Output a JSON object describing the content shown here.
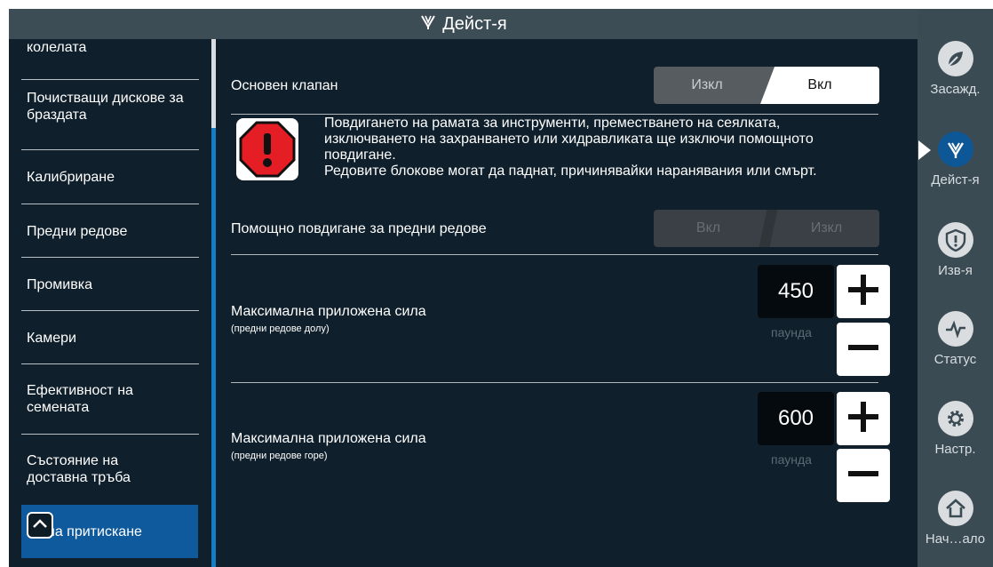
{
  "title": "Дейст-я",
  "left_menu": [
    {
      "label": "колелата"
    },
    {
      "label": "Почистващи дискове за браздата"
    },
    {
      "label": "Калибриране"
    },
    {
      "label": "Предни редове"
    },
    {
      "label": "Промивка"
    },
    {
      "label": "Камери"
    },
    {
      "label": "Ефективност на семената"
    },
    {
      "label": "Състояние на доставна тръба"
    },
    {
      "label": "Сила притискане",
      "active": true
    }
  ],
  "main_valve": {
    "label": "Основен клапан",
    "off": "Изкл",
    "on": "Вкл",
    "state": "Вкл"
  },
  "warning": {
    "line1": "Повдигането на рамата за инструменти, преместването на сеялката,",
    "line2": "изключването на захранването или хидравликата ще изключи помощното",
    "line3": "повдигане.",
    "line4": "Редовите блокове могат да паднат, причинявайки наранявания или смърт."
  },
  "assist_lift": {
    "label": "Помощно повдигане за предни редове",
    "on": "Вкл",
    "off": "Изкл",
    "state": "Изкл",
    "disabled": true
  },
  "force_down": {
    "label": "Максимална приложена сила",
    "sublabel": "(предни редове долу)",
    "value": "450",
    "unit": "паунда"
  },
  "force_up": {
    "label": "Максимална приложена сила",
    "sublabel": "(предни редове горе)",
    "value": "600",
    "unit": "паунда"
  },
  "right_nav": [
    {
      "label": "Засажд.",
      "icon": "planting-icon"
    },
    {
      "label": "Дейст-я",
      "icon": "actions-icon",
      "active": true
    },
    {
      "label": "Изв-я",
      "icon": "alerts-icon"
    },
    {
      "label": "Статус",
      "icon": "status-icon"
    },
    {
      "label": "Настр.",
      "icon": "settings-icon"
    },
    {
      "label": "Нач…ало",
      "icon": "home-icon"
    }
  ],
  "colors": {
    "accent": "#0f5a9d",
    "panel": "#0f1f2b",
    "scroll": "#137fc2"
  }
}
